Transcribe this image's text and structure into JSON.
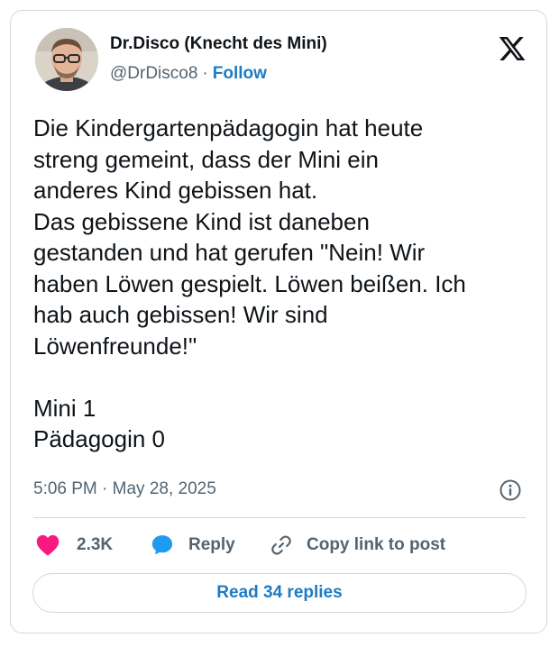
{
  "author": {
    "display_name": "Dr.Disco (Knecht des Mini)",
    "handle": "@DrDisco8",
    "separator": "·",
    "follow_label": "Follow"
  },
  "post": {
    "text": "Die Kindergartenpädagogin hat heute\nstreng gemeint, dass der Mini ein\nanderes Kind gebissen hat.\nDas gebissene Kind ist daneben\ngestanden und hat gerufen \"Nein! Wir\nhaben Löwen gespielt. Löwen beißen. Ich\nhab auch gebissen! Wir sind\nLöwenfreunde!\"\n\nMini 1\nPädagogin 0",
    "timestamp": "5:06 PM · May 28, 2025"
  },
  "actions": {
    "like_count": "2.3K",
    "reply_label": "Reply",
    "copy_link_label": "Copy link to post",
    "read_replies_label": "Read 34 replies"
  },
  "icons": {
    "platform": "x-logo-icon",
    "info": "info-icon",
    "like": "heart-icon",
    "reply": "speech-bubble-icon",
    "copy_link": "link-icon"
  },
  "colors": {
    "accent": "#1d7bc4",
    "heart": "#f91880",
    "reply_bubble": "#1d9bf0",
    "muted_text": "#536471",
    "border": "#cfd9de"
  }
}
